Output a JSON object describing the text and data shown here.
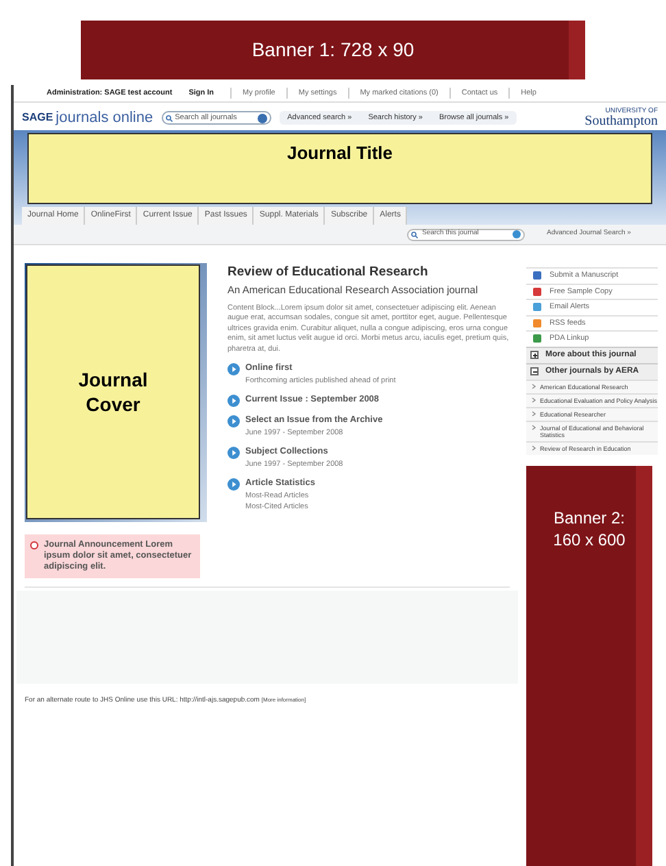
{
  "banner_top": {
    "label": "Banner 1:  728 x 90"
  },
  "top_links": [
    {
      "text": "Administration: SAGE test account",
      "kind": "bold"
    },
    {
      "text": "Sign In",
      "kind": "bold"
    },
    {
      "text": "My profile",
      "kind": "link"
    },
    {
      "text": "My settings",
      "kind": "link"
    },
    {
      "text": "My marked citations (0)",
      "kind": "link"
    },
    {
      "text": "Contact us",
      "kind": "link"
    },
    {
      "text": "Help",
      "kind": "link"
    }
  ],
  "logo": {
    "brand": "SAGE",
    "product": "journals online"
  },
  "global_search": {
    "placeholder": "Search all journals"
  },
  "global_links": [
    "Advanced search »",
    "Search history »",
    "Browse all journals »"
  ],
  "institution": {
    "small": "UNIVERSITY OF",
    "name": "Southampton"
  },
  "journal_title": "Journal Title",
  "tabs": [
    {
      "label": "Journal Home",
      "selected": false
    },
    {
      "label": "OnlineFirst",
      "selected": false
    },
    {
      "label": "Current Issue",
      "selected": false
    },
    {
      "label": "Past Issues",
      "selected": false
    },
    {
      "label": "Suppl. Materials",
      "selected": false
    },
    {
      "label": "Subscribe",
      "selected": false
    },
    {
      "label": "Alerts",
      "selected": false
    }
  ],
  "journal_search": {
    "placeholder": "Search this journal",
    "advanced": "Advanced Journal Search »"
  },
  "cover": {
    "label": "Journal Cover"
  },
  "announcement": "Journal Announcement Lorem ipsum dolor sit amet, consectetuer adipiscing elit.",
  "main": {
    "title": "Review of Educational Research",
    "subtitle": "An American Educational Research Association journal",
    "body": "Content Block...Lorem ipsum dolor sit amet, consectetuer adipiscing elit. Aenean augue erat, accumsan sodales, congue sit amet, porttitor eget, augue. Pellentesque ultrices gravida enim. Curabitur aliquet, nulla a congue adipiscing, eros urna congue enim, sit amet luctus velit augue id orci. Morbi metus arcu, iaculis eget, pretium quis, pharetra at, dui.",
    "sections": [
      {
        "title": "Online first",
        "lines": [
          "Forthcoming articles published ahead of print"
        ]
      },
      {
        "title": "Current Issue : September 2008"
      },
      {
        "title": "Select an Issue from the Archive",
        "lines": [
          "June 1997 - September 2008"
        ]
      },
      {
        "title": "Subject Collections",
        "lines": [
          "June 1997 - September 2008"
        ]
      },
      {
        "title": "Article Statistics",
        "lines": [
          "Most-Read Articles",
          "Most-Cited Articles"
        ]
      }
    ]
  },
  "sidebar": {
    "tools": [
      {
        "label": "Submit a Manuscript",
        "color": "#3b6fc0"
      },
      {
        "label": "Free Sample Copy",
        "color": "#d63a3a"
      },
      {
        "label": "Email Alerts",
        "color": "#4aa0d8"
      },
      {
        "label": "RSS feeds",
        "color": "#f08a2c"
      },
      {
        "label": "PDA Linkup",
        "color": "#3c9a4a"
      }
    ],
    "panels": [
      {
        "title": "More about this journal",
        "expanded": false
      },
      {
        "title": "Other journals by AERA",
        "expanded": true,
        "items": [
          "American Educational Research",
          "Educational Evaluation and Policy Analysis",
          "Educational Researcher",
          "Journal of Educational and Behavioral Statistics",
          "Review of Research in Education"
        ]
      }
    ]
  },
  "footer": {
    "text": "For an alternate route to JHS Online use this URL: http://intl-ajs.sagepub.com",
    "link": "[More information]"
  },
  "banner_side": {
    "label": "Banner 2: 160 x 600"
  }
}
